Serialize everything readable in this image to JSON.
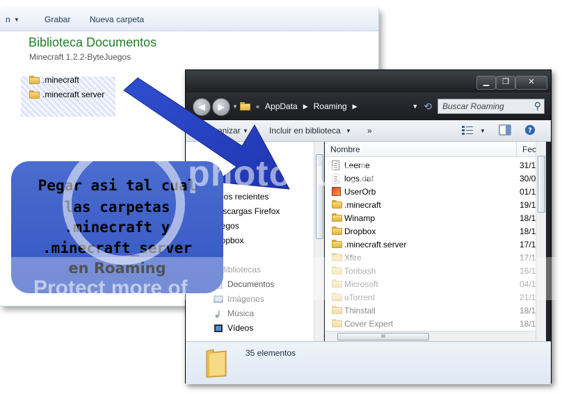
{
  "library_window": {
    "toolbar": [
      "n",
      "Grabar",
      "Nueva carpeta"
    ],
    "title": "Biblioteca Documentos",
    "subtitle": "Minecraft 1.2.2-ByteJuegos",
    "items": [
      ".minecraft",
      ".minecraft server"
    ]
  },
  "annotation": {
    "lines": [
      "Pegar asi tal cual",
      "las carpetas",
      ".minecraft y",
      ".minecraft_server",
      "en Roaming"
    ]
  },
  "watermark": {
    "brand": "photobucket",
    "tagline": "Protect more of"
  },
  "explorer": {
    "caption_buttons": {
      "minimize": "▁",
      "maximize": "❐",
      "close": "✕"
    },
    "breadcrumb": [
      "AppData",
      "Roaming"
    ],
    "search_placeholder": "Buscar Roaming",
    "toolbar": {
      "organize": "Organizar",
      "include": "Incluir en biblioteca",
      "more": "»"
    },
    "nav_items": [
      {
        "label": "Sitios recientes",
        "icon": "recent-places-icon"
      },
      {
        "label": "Descargas Firefox",
        "icon": "download-icon"
      },
      {
        "label": "Juegos",
        "icon": "folder-icon"
      },
      {
        "label": "Dropbox",
        "icon": "folder-icon"
      },
      {
        "label": "Bibliotecas",
        "icon": "library-icon"
      },
      {
        "label": "Documentos",
        "icon": "documents-icon"
      },
      {
        "label": "Imágenes",
        "icon": "pictures-icon"
      },
      {
        "label": "Música",
        "icon": "music-icon"
      },
      {
        "label": "Vídeos",
        "icon": "videos-icon"
      }
    ],
    "columns": {
      "name": "Nombre",
      "date": "Fech"
    },
    "files": [
      {
        "name": "Leeme",
        "date": "31/1",
        "type": "doc"
      },
      {
        "name": "logs.dat",
        "date": "30/0",
        "type": "blank"
      },
      {
        "name": "UserOrb",
        "date": "01/1",
        "type": "app"
      },
      {
        "name": ".minecraft",
        "date": "19/1",
        "type": "folder"
      },
      {
        "name": "Winamp",
        "date": "18/1",
        "type": "folder"
      },
      {
        "name": "Dropbox",
        "date": "18/1",
        "type": "folder"
      },
      {
        "name": ".minecraft server",
        "date": "17/1",
        "type": "folder"
      },
      {
        "name": "Xfire",
        "date": "17/1",
        "type": "folder"
      },
      {
        "name": "Toribash",
        "date": "16/1",
        "type": "folder"
      },
      {
        "name": "Microsoft",
        "date": "04/1",
        "type": "folder"
      },
      {
        "name": "uTorrent",
        "date": "21/1",
        "type": "folder"
      },
      {
        "name": "Thinstall",
        "date": "18/1",
        "type": "folder"
      },
      {
        "name": "Cover Expert",
        "date": "18/1",
        "type": "folder"
      }
    ],
    "hscroll_grip": "III",
    "status": "35 elementos"
  }
}
